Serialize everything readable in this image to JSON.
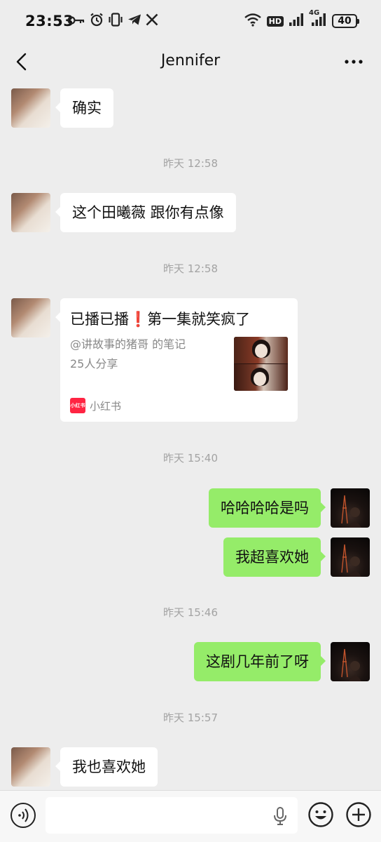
{
  "status_bar": {
    "time": "23:53",
    "network_label": "4G",
    "hd_label": "HD",
    "battery": "40",
    "icons_left": [
      "key-icon",
      "alarm-icon",
      "vibrate-icon",
      "telegram-icon",
      "x-icon"
    ],
    "icons_right": [
      "wifi-icon",
      "hd-icon",
      "signal-icon",
      "signal-4g-icon",
      "battery-icon"
    ]
  },
  "nav": {
    "title": "Jennifer"
  },
  "messages": [
    {
      "type": "text",
      "side": "in",
      "text": "确实"
    },
    {
      "type": "timestamp",
      "text": "昨天 12:58"
    },
    {
      "type": "text",
      "side": "in",
      "text": "这个田曦薇 跟你有点像"
    },
    {
      "type": "timestamp",
      "text": "昨天 12:58"
    },
    {
      "type": "card",
      "side": "in",
      "title": "已播已播❗第一集就笑疯了",
      "author": "@讲故事的猪哥 的笔记",
      "shares": "25人分享",
      "source": "小红书",
      "source_logo_text": "小红书"
    },
    {
      "type": "timestamp",
      "text": "昨天 15:40"
    },
    {
      "type": "text",
      "side": "out",
      "text": "哈哈哈哈是吗"
    },
    {
      "type": "text",
      "side": "out",
      "text": "我超喜欢她"
    },
    {
      "type": "timestamp",
      "text": "昨天 15:46"
    },
    {
      "type": "text",
      "side": "out",
      "text": "这剧几年前了呀"
    },
    {
      "type": "timestamp",
      "text": "昨天 15:57"
    },
    {
      "type": "text",
      "side": "in",
      "text": "我也喜欢她"
    }
  ],
  "input_bar": {
    "value": "",
    "placeholder": ""
  },
  "colors": {
    "background": "#ededed",
    "incoming_bubble": "#ffffff",
    "outgoing_bubble": "#95ec69",
    "timestamp_text": "#a3a3a3",
    "xiaohongshu_red": "#ff2442"
  }
}
